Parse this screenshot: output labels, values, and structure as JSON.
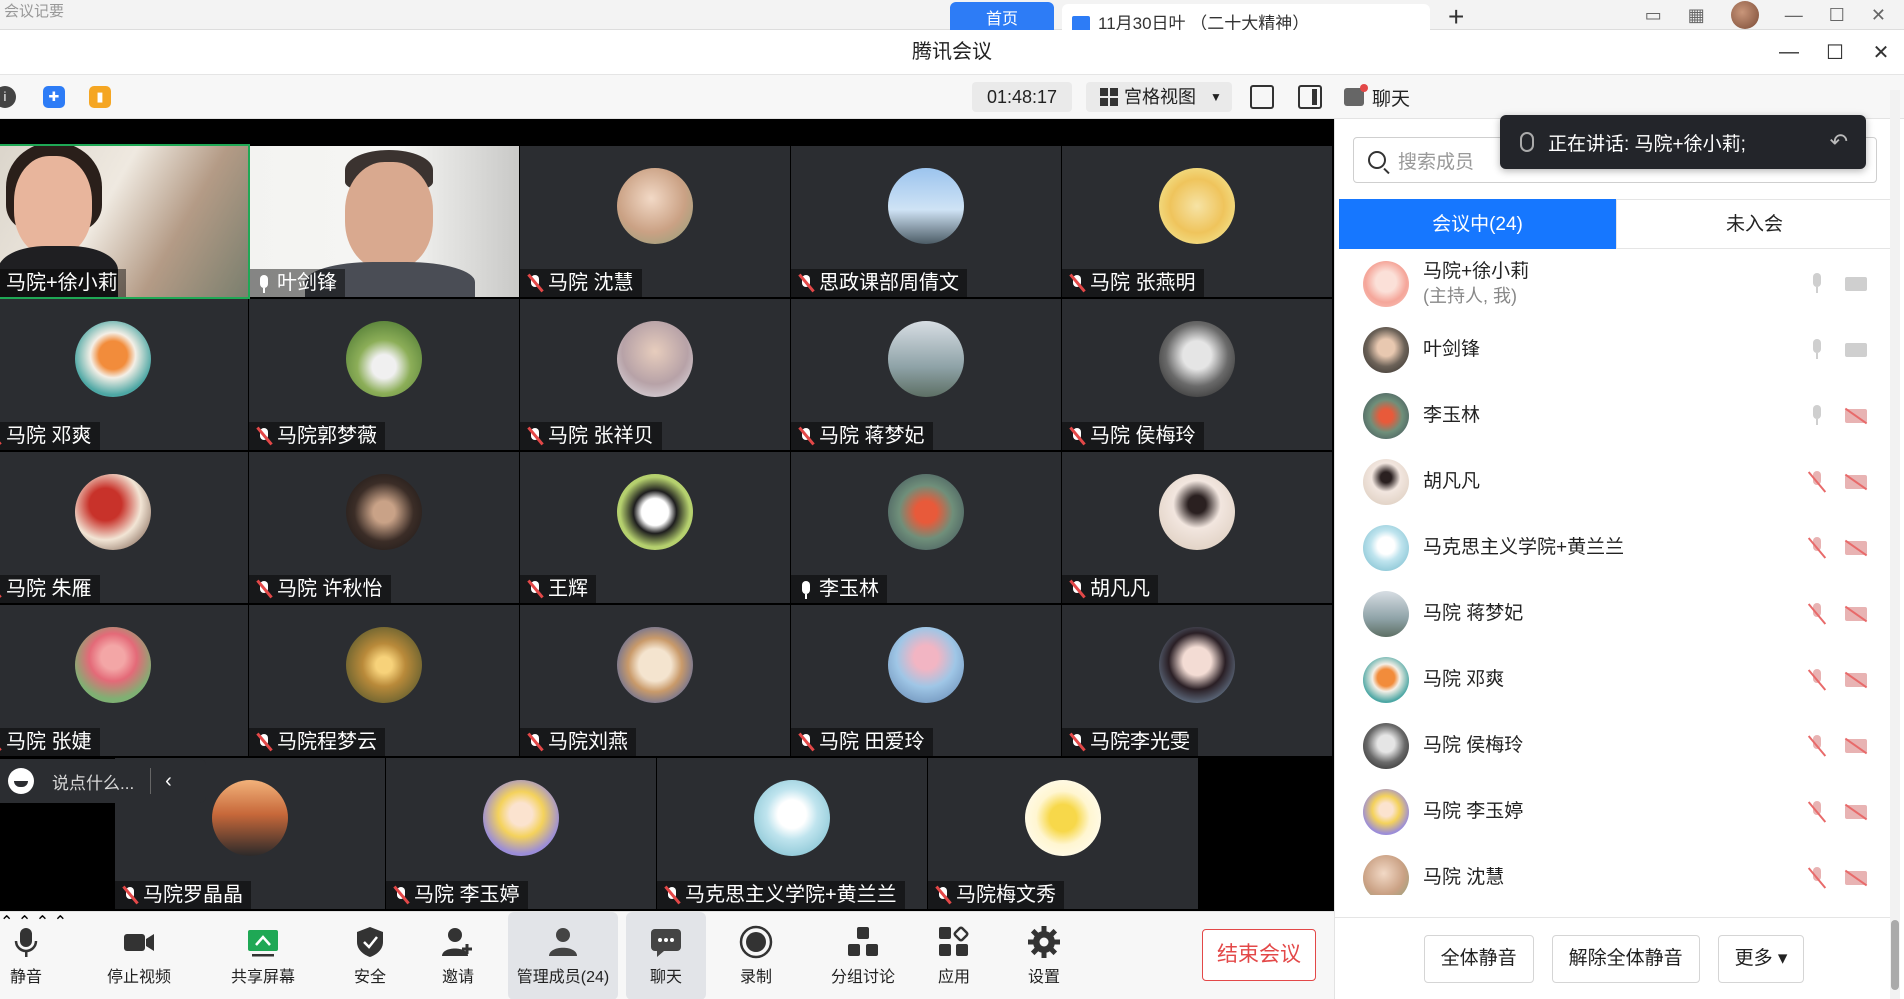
{
  "background": {
    "left_title": "会议记要",
    "tab_home": "首页",
    "tab_doc": "11月30日叶 （二十大精神）"
  },
  "window": {
    "title": "腾讯会议"
  },
  "toolbar": {
    "timer": "01:48:17",
    "view_mode": "宫格视图"
  },
  "chat_panel": {
    "tab_label": "聊天",
    "speaking_label": "正在讲话: 马院+徐小莉;",
    "search_placeholder": "搜索成员",
    "tab_in_meeting": "会议中(24)",
    "tab_not_joined": "未入会",
    "participants": [
      {
        "name": "马院+徐小莉",
        "sub": "(主持人, 我)",
        "mic": "on",
        "cam": "on"
      },
      {
        "name": "叶剑锋",
        "sub": "",
        "mic": "on",
        "cam": "on"
      },
      {
        "name": "李玉林",
        "sub": "",
        "mic": "on",
        "cam": "off"
      },
      {
        "name": "胡凡凡",
        "sub": "",
        "mic": "off",
        "cam": "off"
      },
      {
        "name": "马克思主义学院+黄兰兰",
        "sub": "",
        "mic": "off",
        "cam": "off"
      },
      {
        "name": "马院  蒋梦妃",
        "sub": "",
        "mic": "off",
        "cam": "off"
      },
      {
        "name": "马院 邓爽",
        "sub": "",
        "mic": "off",
        "cam": "off"
      },
      {
        "name": "马院 侯梅玲",
        "sub": "",
        "mic": "off",
        "cam": "off"
      },
      {
        "name": "马院 李玉婷",
        "sub": "",
        "mic": "off",
        "cam": "off"
      },
      {
        "name": "马院 沈慧",
        "sub": "",
        "mic": "off",
        "cam": "off"
      }
    ],
    "mute_all": "全体静音",
    "unmute_all": "解除全体静音",
    "more": "更多"
  },
  "tiles": [
    {
      "name": "马院+徐小莉",
      "mic": "on",
      "video": "cam1"
    },
    {
      "name": "叶剑锋",
      "mic": "on",
      "video": "cam2"
    },
    {
      "name": "马院 沈慧",
      "mic": "off",
      "avatar": "a1"
    },
    {
      "name": "思政课部周倩文",
      "mic": "off",
      "avatar": "a2"
    },
    {
      "name": "马院 张燕明",
      "mic": "off",
      "avatar": "a3"
    },
    {
      "name": "马院 邓爽",
      "mic": "off",
      "avatar": "a4"
    },
    {
      "name": "马院郭梦薇",
      "mic": "off",
      "avatar": "a5"
    },
    {
      "name": "马院 张祥贝",
      "mic": "off",
      "avatar": "a6"
    },
    {
      "name": "马院  蒋梦妃",
      "mic": "off",
      "avatar": "a7"
    },
    {
      "name": "马院 侯梅玲",
      "mic": "off",
      "avatar": "a8"
    },
    {
      "name": "马院 朱雁",
      "mic": "off",
      "avatar": "a9"
    },
    {
      "name": "马院 许秋怡",
      "mic": "off",
      "avatar": "a10"
    },
    {
      "name": "王辉",
      "mic": "off",
      "avatar": "a11"
    },
    {
      "name": "李玉林",
      "mic": "on",
      "avatar": "a12"
    },
    {
      "name": "胡凡凡",
      "mic": "off",
      "avatar": "a13"
    },
    {
      "name": "马院 张婕",
      "mic": "off",
      "avatar": "a14"
    },
    {
      "name": "马院程梦云",
      "mic": "off",
      "avatar": "a15"
    },
    {
      "name": "马院刘燕",
      "mic": "off",
      "avatar": "a16"
    },
    {
      "name": "马院 田爱玲",
      "mic": "off",
      "avatar": "a17"
    },
    {
      "name": "马院李光雯",
      "mic": "off",
      "avatar": "a18"
    },
    {
      "name": "马院罗晶晶",
      "mic": "off",
      "avatar": "a19"
    },
    {
      "name": "马院 李玉婷",
      "mic": "off",
      "avatar": "a20"
    },
    {
      "name": "马克思主义学院+黄兰兰",
      "mic": "off",
      "avatar": "a21"
    },
    {
      "name": "马院梅文秀",
      "mic": "off",
      "avatar": "a22"
    }
  ],
  "chat_input": {
    "placeholder": "说点什么..."
  },
  "bottombar": {
    "mute": "静音",
    "stop_video": "停止视频",
    "share_screen": "共享屏幕",
    "security": "安全",
    "invite": "邀请",
    "manage_members": "管理成员(24)",
    "chat": "聊天",
    "record": "录制",
    "breakout": "分组讨论",
    "apps": "应用",
    "settings": "设置",
    "end_meeting": "结束会议"
  }
}
